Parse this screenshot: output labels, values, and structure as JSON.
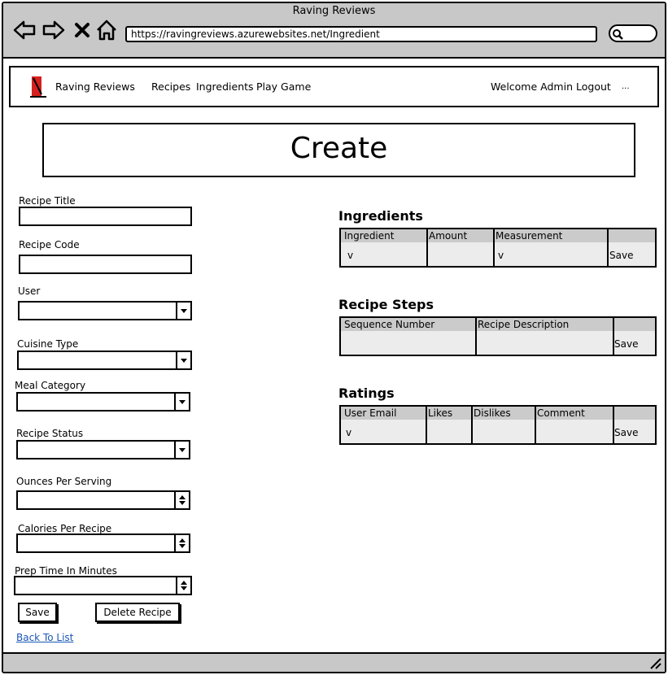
{
  "window": {
    "title": "Raving Reviews",
    "url": "https://ravingreviews.azurewebsites.net/Ingredient"
  },
  "toolbar": {
    "back_icon": "arrow-left-icon",
    "forward_icon": "arrow-right-icon",
    "stop_icon": "close-icon",
    "home_icon": "home-icon",
    "search_icon": "search-icon"
  },
  "header": {
    "brand": "Raving Reviews",
    "nav": [
      "Recipes",
      "Ingredients",
      "Play Game"
    ],
    "welcome": "Welcome Admin",
    "logout": "Logout",
    "more": "..."
  },
  "page": {
    "title": "Create"
  },
  "form": {
    "recipe_title_label": "Recipe Title",
    "recipe_code_label": "Recipe Code",
    "user_label": "User",
    "cuisine_type_label": "Cuisine Type",
    "meal_category_label": "Meal Category",
    "recipe_status_label": "Recipe Status",
    "ounces_label": "Ounces Per Serving",
    "calories_label": "Calories Per Recipe",
    "prep_time_label": "Prep Time In Minutes",
    "save_label": "Save",
    "delete_label": "Delete Recipe",
    "back_label": "Back To List"
  },
  "ingredients": {
    "title": "Ingredients",
    "columns": [
      "Ingredient",
      "Amount",
      "Measurement",
      ""
    ],
    "row": [
      "v",
      "",
      "v",
      "Save"
    ]
  },
  "steps": {
    "title": "Recipe Steps",
    "columns": [
      "Sequence Number",
      "Recipe Description",
      ""
    ],
    "row": [
      "",
      "",
      "Save"
    ]
  },
  "ratings": {
    "title": "Ratings",
    "columns": [
      "User Email",
      "Likes",
      "Dislikes",
      "Comment",
      ""
    ],
    "row": [
      "v",
      "",
      "",
      "",
      "Save"
    ]
  },
  "colors": {
    "chrome": "#c8c8c8",
    "grid_header": "#cbcbcb",
    "grid_body": "#ececec",
    "link": "#1a56b8",
    "logo_red": "#d42020"
  }
}
